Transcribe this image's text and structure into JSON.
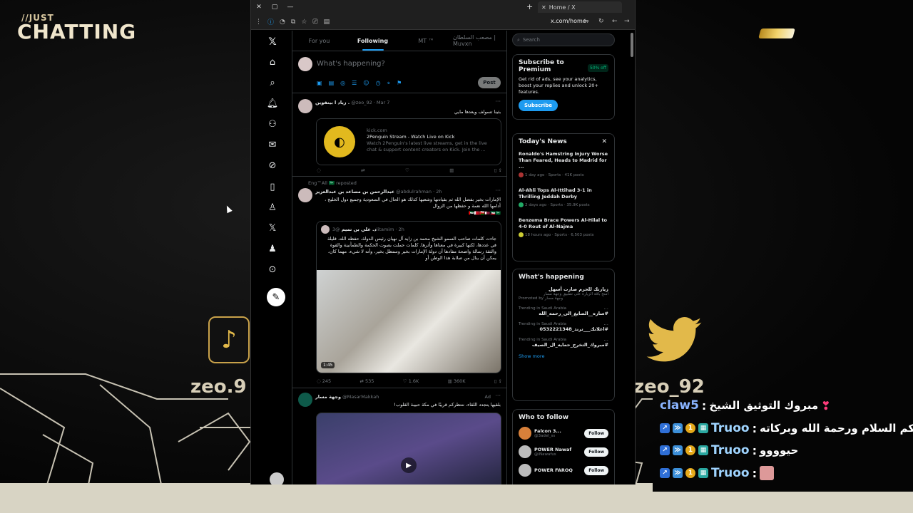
{
  "overlay": {
    "just_label": "//JUST",
    "chatting_label": "CHATTING",
    "handle_left": "zeo.9",
    "handle_right": "zeo_92",
    "tiktok_glyph": "♪"
  },
  "browser": {
    "tab_title": "Home / X",
    "url": "x.com/home",
    "tab_close": "✕"
  },
  "nav": {
    "post_icon": "✎"
  },
  "feed": {
    "tabs": [
      {
        "label": "For you"
      },
      {
        "label": "Following"
      },
      {
        "label": "MT ™"
      },
      {
        "label": "مصعب السلطان | Muvxn"
      }
    ],
    "compose": {
      "placeholder": "What's happening?",
      "post_label": "Post"
    },
    "tweet1": {
      "name": "زياد ا بينقوين .",
      "meta": "@zeo_92 · Mar 7",
      "text": "بثينا تسولف ويعدها مايي",
      "card": {
        "domain": "kick.com",
        "title": "2Penguin Stream - Watch Live on Kick",
        "desc": "Watch 2Penguin's latest live streams, get in the live chat & support content creators on Kick. Join the ..."
      }
    },
    "tweet2": {
      "repost_label": "Eng™All 🇸🇦 reposted",
      "name": "عبدالرحمن بن مساعد بن عبدالعزيز",
      "meta": "@abdulrahman · 2h",
      "text": "الإمارات بخير بفضل الله ثم بقيادتها وشعبها كذلك هو الحال في السعودية وجميع دول الخليج ، أدامها الله نعمة و حفظها من الزوال",
      "flags": "🇦🇪🇧🇭🇴🇲🇶🇦🇰🇼🇸🇦",
      "quote": {
        "name": "د. علي بن تميم",
        "meta": "@3litamim · 2h",
        "text": "جاءت كلمات صاحب السمو الشيخ محمد بن زايد آل نهيان رئيس الدولة، حفظه الله، قليلة في عددها، لكنها كبيرة في معناها وأثرها. كلمات حملت بصوت الحكمة والطمأنينة والقوة والثقة رسالة واضحة مفادها أن دولة الإمارات بخير وستظل بخير، وأنه لا شيء، مهما كان، يمكن أن ينال من صلابة هذا الوطن أو",
        "duration": "1:45"
      },
      "actions": {
        "replies": "245",
        "reposts": "535",
        "likes": "1.6K",
        "views": "360K"
      }
    },
    "tweet3": {
      "name": "وجهة مسار",
      "meta": "@MasarMakkah",
      "ad": "Ad",
      "text": "بلقيها يتجدد اللقاء، ننتظركم قريبًا في مكة حبيبة القلوب!"
    }
  },
  "right": {
    "search_placeholder": "Search",
    "premium": {
      "title": "Subscribe to Premium",
      "badge": "50% off",
      "desc": "Get rid of ads, see your analytics, boost your replies and unlock 20+ features.",
      "button": "Subscribe"
    },
    "news": {
      "title": "Today's News",
      "items": [
        {
          "title": "Ronaldo's Hamstring Injury Worse Than Feared, Heads to Madrid for ...",
          "meta": "1 day ago · Sports · 41K posts"
        },
        {
          "title": "Al-Ahli Tops Al-Ittihad 3-1 in Thrilling Jeddah Derby",
          "meta": "2 days ago · Sports · 35.9K posts"
        },
        {
          "title": "Benzema Brace Powers Al-Hilal to 4-0 Rout of Al-Najma",
          "meta": "18 hours ago · Sports · 6,503 posts"
        }
      ]
    },
    "happening": {
      "title": "What's happening",
      "promo_title": "زيارتك للحرم صارت أسهل",
      "promo_desc": "امنح باقة الزيارة على تطبيق وجهة مسار",
      "promo_by": "Promoted by وجهة مسار",
      "trends": [
        {
          "label": "Trending in Saudi Arabia",
          "tag": "#ساره__الصايغ_الى_رحمه_الله"
        },
        {
          "label": "Trending in Saudi Arabia",
          "tag": "#اعلانك___ترند_0532221348"
        },
        {
          "label": "Trending in Saudi Arabia",
          "tag": "#مبروك_التخرج_حمايه_ال_الصيف"
        }
      ],
      "show_more": "Show more"
    },
    "follow": {
      "title": "Who to follow",
      "people": [
        {
          "name": "Falcon 3...",
          "handle": "@3adel_ss",
          "button": "Follow"
        },
        {
          "name": "POWER Nawaf",
          "handle": "@iNawafus",
          "button": "Follow"
        },
        {
          "name": "POWER FAROQ",
          "handle": "",
          "button": "Follow"
        }
      ]
    }
  },
  "chat": {
    "messages": [
      {
        "user": "claw5",
        "sep": ":",
        "text": "مبروك التوثيق الشيخ"
      },
      {
        "user": "Truoo",
        "sep": ":",
        "text": "وعليكم السلام ورحمة الله وبركاته"
      },
      {
        "user": "Truoo",
        "sep": ":",
        "text": "حيوووو"
      },
      {
        "user": "Truoo",
        "sep": ":",
        "text": ""
      }
    ]
  },
  "colors": {
    "accent": "#1d9bf0",
    "gold": "#e2b91e",
    "chat_user": "#9fd4ff"
  }
}
